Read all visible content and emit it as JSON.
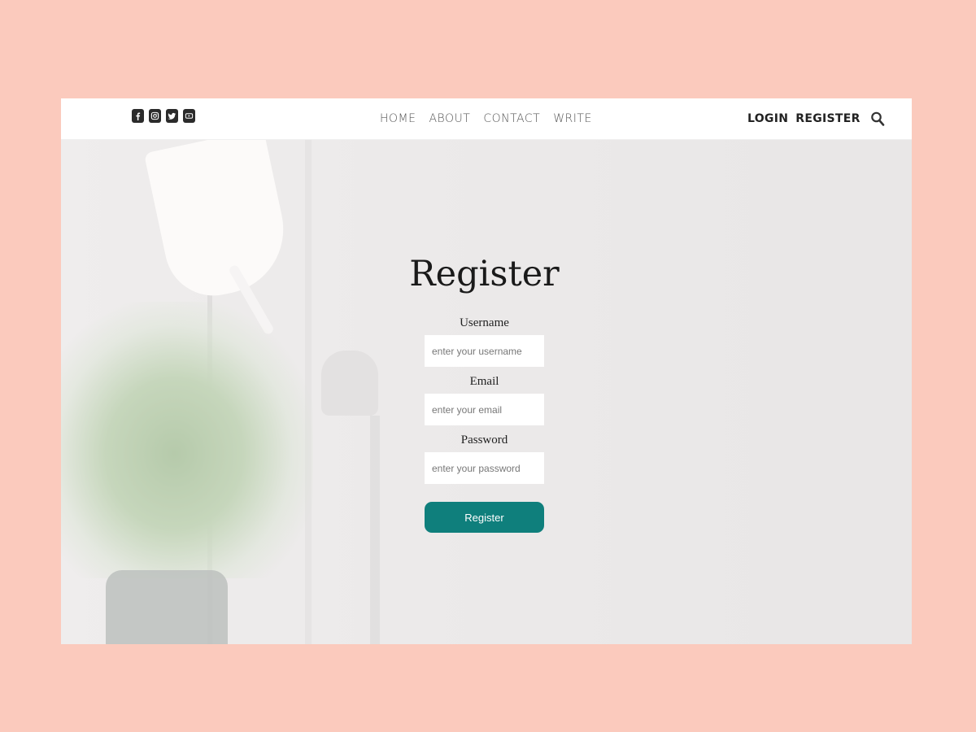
{
  "nav": {
    "social_icons": [
      "facebook-icon",
      "instagram-icon",
      "twitter-icon",
      "youtube-icon"
    ],
    "links": [
      "HOME",
      "ABOUT",
      "CONTACT",
      "WRITE"
    ],
    "login": "LOGIN",
    "register": "REGISTER",
    "search_icon": "search-icon"
  },
  "form": {
    "title": "Register",
    "username_label": "Username",
    "username_placeholder": "enter your username",
    "email_label": "Email",
    "email_placeholder": "enter your email",
    "password_label": "Password",
    "password_placeholder": "enter your password",
    "submit_label": "Register"
  },
  "colors": {
    "page_background": "#fbcabd",
    "button": "#0f7f7c",
    "nav_text": "#555555"
  }
}
